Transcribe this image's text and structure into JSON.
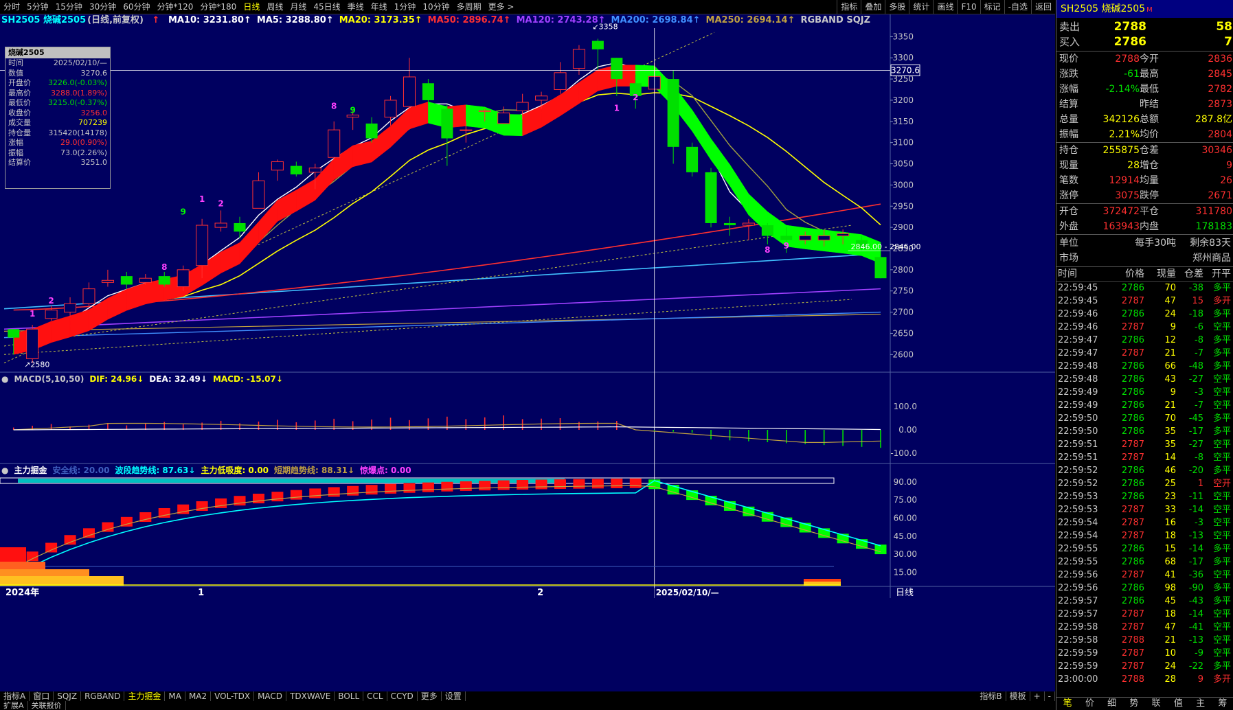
{
  "colors": {
    "up": "#ff3030",
    "down": "#00e000",
    "white": "#ffffff",
    "yellow": "#ffff00",
    "cyan": "#00ffff",
    "grid": "#3050a0",
    "bg": "#000060"
  },
  "topbar": {
    "left": [
      "分时",
      "5分钟",
      "15分钟",
      "30分钟",
      "60分钟",
      "分钟*120",
      "分钟*180",
      "日线",
      "周线",
      "月线",
      "45日线",
      "季线",
      "年线",
      "1分钟",
      "10分钟",
      "多周期",
      "更多 >"
    ],
    "active": "日线",
    "right": [
      "指标",
      "叠加",
      "多股",
      "统计",
      "画线",
      "F10",
      "标记",
      "-自选",
      "返回"
    ]
  },
  "legend": {
    "symbol": "SH2505 烧碱2505",
    "mode": "(日线,前复权)",
    "items": [
      {
        "text": "MA10: 3231.80↑",
        "color": "#ffffff"
      },
      {
        "text": "MA5: 3288.80↑",
        "color": "#ffffff"
      },
      {
        "text": "MA20: 3173.35↑",
        "color": "#ffff00"
      },
      {
        "text": "MA50: 2896.74↑",
        "color": "#ff3030"
      },
      {
        "text": "MA120: 2743.28↑",
        "color": "#a040ff"
      },
      {
        "text": "MA200: 2698.84↑",
        "color": "#4090ff"
      },
      {
        "text": "MA250: 2694.14↑",
        "color": "#c0a040"
      },
      {
        "text": "RGBAND SQJZ",
        "color": "#c8c8c8"
      }
    ]
  },
  "infobox": {
    "title": "烧碱2505",
    "rows": [
      {
        "k": "时间",
        "v": "2025/02/10/—",
        "c": "#c8c8c8"
      },
      {
        "k": "数值",
        "v": "3270.6",
        "c": "#c8c8c8"
      },
      {
        "k": "开盘价",
        "v": "3226.0(-0.03%)",
        "c": "#00e000"
      },
      {
        "k": "最高价",
        "v": "3288.0(1.89%)",
        "c": "#ff3030"
      },
      {
        "k": "最低价",
        "v": "3215.0(-0.37%)",
        "c": "#00e000"
      },
      {
        "k": "收盘价",
        "v": "3256.0",
        "c": "#ff3030"
      },
      {
        "k": "成交量",
        "v": "707239",
        "c": "#ffff00"
      },
      {
        "k": "持仓量",
        "v": "315420(14178)",
        "c": "#c8c8c8"
      },
      {
        "k": "涨幅",
        "v": "29.0(0.90%)",
        "c": "#ff3030"
      },
      {
        "k": "振幅",
        "v": "73.0(2.26%)",
        "c": "#c8c8c8"
      },
      {
        "k": "结算价",
        "v": "3251.0",
        "c": "#c8c8c8"
      }
    ]
  },
  "price_axis": {
    "min": 2560,
    "max": 3370,
    "ticks": [
      "3350",
      "3300",
      "3250",
      "3200",
      "3150",
      "3100",
      "3050",
      "3000",
      "2950",
      "2900",
      "2850",
      "2800",
      "2750",
      "2700",
      "2650",
      "2600"
    ],
    "crosshair_label": "3270.6",
    "range_label": "2846.00 - 2845.00",
    "high_label": "3358",
    "low_label": "2580"
  },
  "macd": {
    "title": "MACD(5,10,50)",
    "dif": "DIF: 24.96↓",
    "dea": "DEA: 32.49↓",
    "macd": "MACD: -15.07↓",
    "ticks": [
      "100.0",
      "0.00",
      "-100.0"
    ]
  },
  "zljj": {
    "title": "主力掘金",
    "safe": "安全线: 20.00",
    "wave": "波段趋势线: 87.63↓",
    "low": "主力低吸度: 0.00",
    "short": "短期趋势线: 88.31↓",
    "burst": "惊爆点: 0.00",
    "ticks": [
      "90.00",
      "75.00",
      "60.00",
      "45.00",
      "30.00",
      "15.00"
    ]
  },
  "xaxis": {
    "labels": [
      "2024年",
      "1",
      "2"
    ],
    "crosshair": "2025/02/10/—",
    "period": "日线"
  },
  "bottombar": {
    "items": [
      "指标A",
      "窗口",
      "SQJZ",
      "RGBAND",
      "主力掘金",
      "MA",
      "MA2",
      "VOL-TDX",
      "MACD",
      "TDXWAVE",
      "BOLL",
      "CCL",
      "CCYD",
      "更多",
      "设置"
    ],
    "active": "主力掘金",
    "right": [
      "指标B",
      "模板",
      "+",
      "-"
    ]
  },
  "statusbar": [
    "扩展A",
    "关联报价"
  ],
  "chart_data": {
    "type": "candlestick",
    "candles": [
      [
        2660,
        2640,
        2660,
        2600
      ],
      [
        2590,
        2660,
        2670,
        2580
      ],
      [
        2685,
        2705,
        2715,
        2680
      ],
      [
        2700,
        2720,
        2735,
        2690
      ],
      [
        2720,
        2755,
        2770,
        2715
      ],
      [
        2770,
        2775,
        2800,
        2760
      ],
      [
        2785,
        2765,
        2795,
        2755
      ],
      [
        2770,
        2780,
        2790,
        2765
      ],
      [
        2785,
        2765,
        2795,
        2760
      ],
      [
        2760,
        2800,
        2810,
        2750
      ],
      [
        2810,
        2905,
        2920,
        2780
      ],
      [
        2900,
        2910,
        2940,
        2890
      ],
      [
        2910,
        2890,
        2925,
        2875
      ],
      [
        2945,
        3010,
        3030,
        2945
      ],
      [
        3035,
        3055,
        3060,
        3010
      ],
      [
        3045,
        3025,
        3055,
        3020
      ],
      [
        3030,
        3040,
        3050,
        2990
      ],
      [
        3065,
        3130,
        3150,
        3060
      ],
      [
        3160,
        3165,
        3175,
        3130
      ],
      [
        3145,
        3110,
        3160,
        3100
      ],
      [
        3160,
        3200,
        3210,
        3140
      ],
      [
        3185,
        3255,
        3300,
        3180
      ],
      [
        3240,
        3200,
        3250,
        3190
      ],
      [
        3180,
        3110,
        3190,
        3045
      ],
      [
        3130,
        3130,
        3150,
        3100
      ],
      [
        3175,
        3175,
        3180,
        3150
      ],
      [
        3145,
        3170,
        3185,
        3150
      ],
      [
        3175,
        3195,
        3215,
        3155
      ],
      [
        3200,
        3210,
        3220,
        3180
      ],
      [
        3225,
        3265,
        3290,
        3215
      ],
      [
        3275,
        3320,
        3330,
        3260
      ],
      [
        3340,
        3320,
        3345,
        3270
      ],
      [
        3300,
        3250,
        3300,
        3210
      ],
      [
        3240,
        3210,
        3260,
        3180
      ],
      [
        3226,
        3256,
        3288,
        3215
      ],
      [
        3250,
        3090,
        3270,
        3050
      ],
      [
        3090,
        3030,
        3100,
        3020
      ],
      [
        3030,
        2910,
        3040,
        2900
      ],
      [
        2910,
        2905,
        2925,
        2880
      ],
      [
        2905,
        2910,
        2920,
        2870
      ],
      [
        2905,
        2880,
        2910,
        2860
      ],
      [
        2880,
        2870,
        2900,
        2840
      ],
      [
        2870,
        2880,
        2890,
        2860
      ],
      [
        2870,
        2880,
        2895,
        2855
      ],
      [
        2880,
        2885,
        2895,
        2860
      ],
      [
        2870,
        2850,
        2880,
        2845
      ],
      [
        2830,
        2780,
        2840,
        2780
      ]
    ]
  },
  "right_panel": {
    "title": "SH2505 烧碱2505",
    "sell": {
      "label": "卖出",
      "price": "2788",
      "vol": "58"
    },
    "buy": {
      "label": "买入",
      "price": "2786",
      "vol": "7"
    },
    "quote": [
      [
        "现价",
        "2788",
        "今开",
        "2836"
      ],
      [
        "涨跌",
        "-61",
        "最高",
        "2845"
      ],
      [
        "涨幅",
        "-2.14%",
        "最低",
        "2782"
      ],
      [
        "结算",
        "",
        "昨结",
        "2873"
      ],
      [
        "总量",
        "342126",
        "总额",
        "287.8亿"
      ],
      [
        "振幅",
        "2.21%",
        "均价",
        "2804"
      ]
    ],
    "quote2": [
      [
        "持仓",
        "255875",
        "仓差",
        "30346"
      ],
      [
        "现量",
        "28",
        "增仓",
        "9"
      ],
      [
        "笔数",
        "12914",
        "均量",
        "26"
      ],
      [
        "涨停",
        "3075",
        "跌停",
        "2671"
      ]
    ],
    "quote3": [
      [
        "开仓",
        "372472",
        "平仓",
        "311780"
      ],
      [
        "外盘",
        "163943",
        "内盘",
        "178183"
      ]
    ],
    "unit": {
      "label": "单位",
      "value": "每手30吨",
      "remain": "剩余83天"
    },
    "market": {
      "label": "市场",
      "value": "郑州商品"
    },
    "tick_header": [
      "时间",
      "价格",
      "现量",
      "仓差",
      "开平"
    ],
    "ticks": [
      [
        "22:59:45",
        "2786",
        "70",
        "-38",
        "多平"
      ],
      [
        "22:59:45",
        "2787",
        "47",
        "15",
        "多开"
      ],
      [
        "22:59:46",
        "2786",
        "24",
        "-18",
        "多平"
      ],
      [
        "22:59:46",
        "2787",
        "9",
        "-6",
        "空平"
      ],
      [
        "22:59:47",
        "2786",
        "12",
        "-8",
        "多平"
      ],
      [
        "22:59:47",
        "2787",
        "21",
        "-7",
        "多平"
      ],
      [
        "22:59:48",
        "2786",
        "66",
        "-48",
        "多平"
      ],
      [
        "22:59:48",
        "2786",
        "43",
        "-27",
        "空平"
      ],
      [
        "22:59:49",
        "2786",
        "9",
        "-3",
        "空平"
      ],
      [
        "22:59:49",
        "2786",
        "21",
        "-7",
        "空平"
      ],
      [
        "22:59:50",
        "2786",
        "70",
        "-45",
        "多平"
      ],
      [
        "22:59:50",
        "2786",
        "35",
        "-17",
        "多平"
      ],
      [
        "22:59:51",
        "2787",
        "35",
        "-27",
        "空平"
      ],
      [
        "22:59:51",
        "2787",
        "14",
        "-8",
        "空平"
      ],
      [
        "22:59:52",
        "2786",
        "46",
        "-20",
        "多平"
      ],
      [
        "22:59:52",
        "2786",
        "25",
        "1",
        "空开"
      ],
      [
        "22:59:53",
        "2786",
        "23",
        "-11",
        "空平"
      ],
      [
        "22:59:53",
        "2787",
        "33",
        "-14",
        "空平"
      ],
      [
        "22:59:54",
        "2787",
        "16",
        "-3",
        "空平"
      ],
      [
        "22:59:54",
        "2787",
        "18",
        "-13",
        "空平"
      ],
      [
        "22:59:55",
        "2786",
        "15",
        "-14",
        "多平"
      ],
      [
        "22:59:55",
        "2786",
        "68",
        "-17",
        "多平"
      ],
      [
        "22:59:56",
        "2787",
        "41",
        "-36",
        "空平"
      ],
      [
        "22:59:56",
        "2786",
        "98",
        "-90",
        "多平"
      ],
      [
        "22:59:57",
        "2786",
        "45",
        "-43",
        "多平"
      ],
      [
        "22:59:57",
        "2787",
        "18",
        "-14",
        "空平"
      ],
      [
        "22:59:58",
        "2787",
        "47",
        "-41",
        "空平"
      ],
      [
        "22:59:58",
        "2788",
        "21",
        "-13",
        "空平"
      ],
      [
        "22:59:59",
        "2787",
        "10",
        "-9",
        "空平"
      ],
      [
        "22:59:59",
        "2787",
        "24",
        "-22",
        "多平"
      ],
      [
        "23:00:00",
        "2788",
        "28",
        "9",
        "多开"
      ]
    ],
    "bottom_tabs": [
      "笔",
      "价",
      "细",
      "势",
      "联",
      "值",
      "主",
      "筹"
    ],
    "active_tab": "笔"
  }
}
